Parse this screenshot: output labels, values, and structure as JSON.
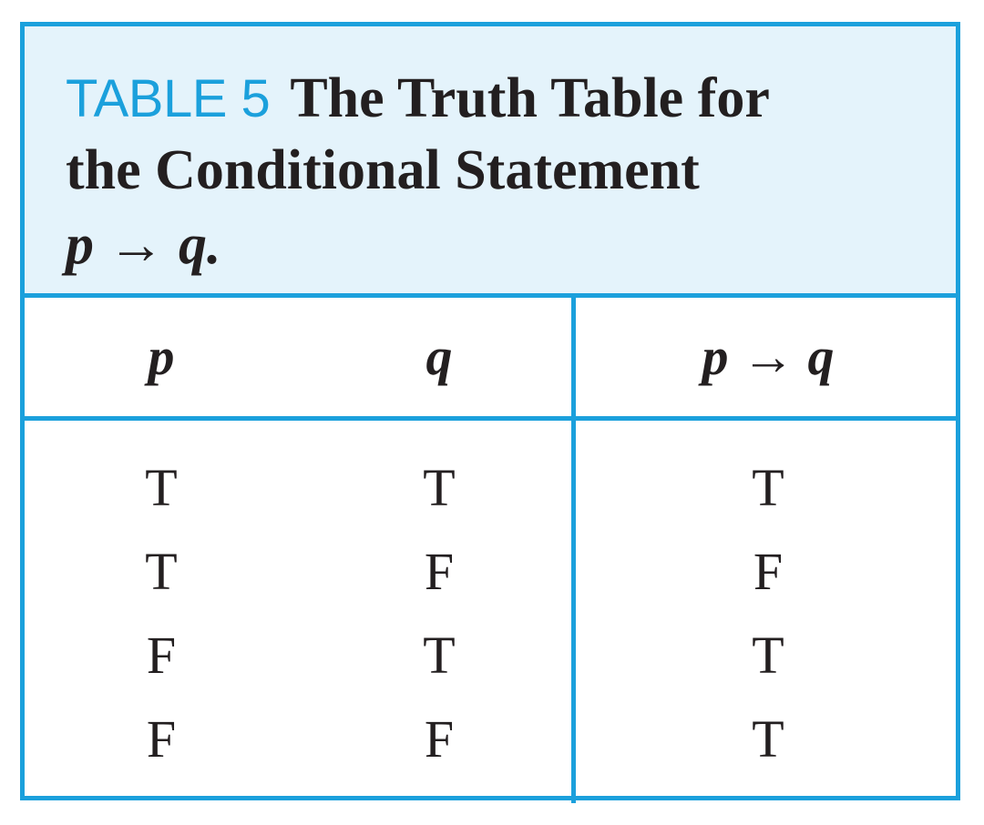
{
  "caption": {
    "label": "TABLE 5",
    "title_line1": "The Truth Table for",
    "title_line2": "the Conditional Statement",
    "formula": "p → q."
  },
  "table": {
    "headers": [
      "p",
      "q",
      "p → q"
    ],
    "rows": [
      [
        "T",
        "T",
        "T"
      ],
      [
        "T",
        "F",
        "F"
      ],
      [
        "F",
        "T",
        "T"
      ],
      [
        "F",
        "F",
        "T"
      ]
    ]
  },
  "colors": {
    "accent": "#1ba0dc",
    "caption_background": "#e4f3fb",
    "text": "#231f20"
  }
}
